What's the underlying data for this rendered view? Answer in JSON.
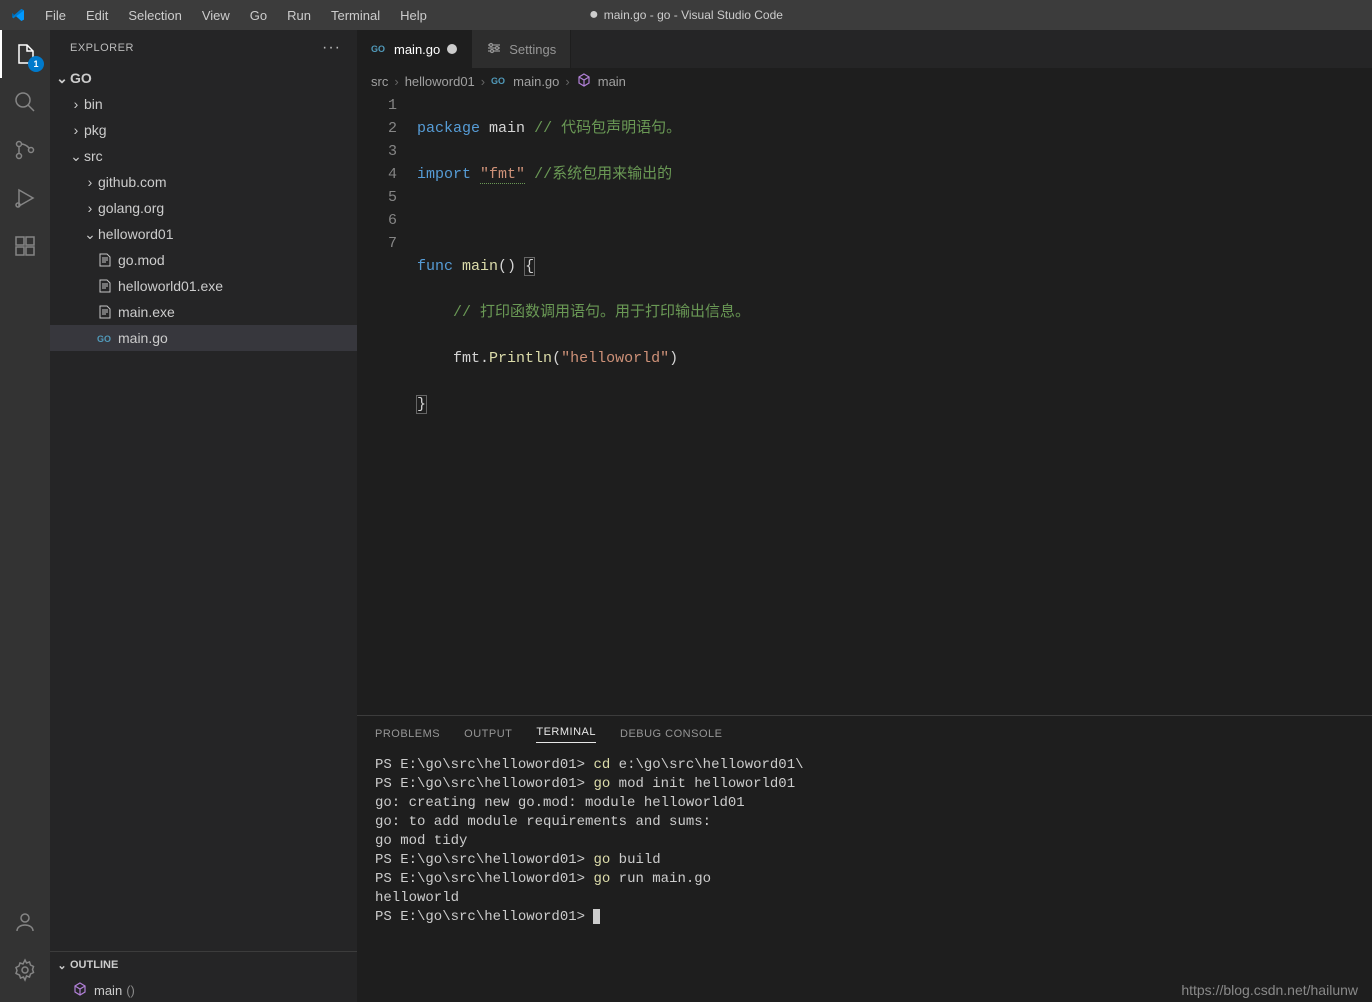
{
  "window": {
    "title": "main.go - go - Visual Studio Code",
    "dirty_marker": "●"
  },
  "menubar": [
    "File",
    "Edit",
    "Selection",
    "View",
    "Go",
    "Run",
    "Terminal",
    "Help"
  ],
  "activitybar": {
    "badge": "1"
  },
  "sidebar": {
    "title": "EXPLORER",
    "root": "GO",
    "tree": {
      "bin": "bin",
      "pkg": "pkg",
      "src": "src",
      "github": "github.com",
      "golang": "golang.org",
      "helloword01": "helloword01",
      "gomod": "go.mod",
      "hwexe": "helloworld01.exe",
      "mainexe": "main.exe",
      "maingo": "main.go"
    },
    "outline": {
      "title": "OUTLINE",
      "main": "main",
      "paren": "()"
    }
  },
  "tabs": {
    "main": "main.go",
    "settings": "Settings"
  },
  "breadcrumb": {
    "src": "src",
    "hw": "helloword01",
    "file": "main.go",
    "func": "main"
  },
  "code": {
    "line_numbers": [
      "1",
      "2",
      "3",
      "4",
      "5",
      "6",
      "7"
    ],
    "l1": {
      "package": "package",
      "main": "main",
      "comment": "// 代码包声明语句。"
    },
    "l2": {
      "import": "import",
      "fmt": "\"fmt\"",
      "comment": "//系统包用来输出的"
    },
    "l4": {
      "func": "func",
      "main": "main",
      "paren": "()",
      "brace": "{"
    },
    "l5": {
      "comment": "// 打印函数调用语句。用于打印输出信息。"
    },
    "l6": {
      "fmt": "fmt",
      "dot": ".",
      "println": "Println",
      "open": "(",
      "str": "\"helloworld\"",
      "close": ")"
    },
    "l7": {
      "brace": "}"
    }
  },
  "panel_tabs": {
    "problems": "PROBLEMS",
    "output": "OUTPUT",
    "terminal": "TERMINAL",
    "debug": "DEBUG CONSOLE"
  },
  "terminal": {
    "prompt": "PS E:\\go\\src\\helloword01>",
    "cd": "cd",
    "cd_arg": "e:\\go\\src\\helloword01\\",
    "go": "go",
    "mod_init": "mod init helloworld01",
    "creating": "go: creating new go.mod: module helloworld01",
    "toadd": "go: to add module requirements and sums:",
    "tidy": "        go mod tidy",
    "build": "build",
    "run": "run main.go",
    "hello": "helloworld"
  },
  "watermark": "https://blog.csdn.net/hailunw"
}
